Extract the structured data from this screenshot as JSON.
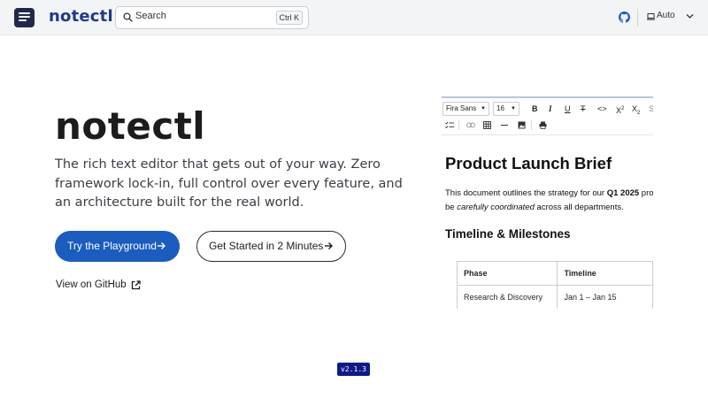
{
  "header": {
    "brand": "notectl",
    "search": {
      "placeholder": "Search",
      "shortcut": "Ctrl K"
    },
    "theme": {
      "label": "Auto"
    },
    "icons": {
      "logo": "notectl-logo-icon",
      "search": "search-icon",
      "github": "github-icon",
      "monitor": "monitor-icon",
      "chevron": "chevron-down-icon"
    },
    "accent_color": "#1d3a8a"
  },
  "hero": {
    "title": "notectl",
    "description": "The rich text editor that gets out of your way. Zero framework lock-in, full control over every feature, and an architecture built for the real world.",
    "primary_button": "Try the Playground",
    "secondary_button": "Get Started in 2 Minutes",
    "github_link": "View on GitHub",
    "primary_color": "#1a5cbf"
  },
  "editor_preview": {
    "toolbar": {
      "font_family": "Fira Sans",
      "font_size": "16",
      "buttons": [
        "bold",
        "italic",
        "underline",
        "strikethrough",
        "code",
        "superscript",
        "subscript",
        "checklist",
        "link",
        "table",
        "horizontal-rule",
        "image",
        "print"
      ]
    },
    "document": {
      "heading": "Product Launch Brief",
      "para_part1": "This document outlines the strategy for our ",
      "para_bold": "Q1 2025",
      "para_part2": " produc",
      "para_part3": "be ",
      "para_italic": "carefully coordinated",
      "para_part4": " across all departments.",
      "subheading": "Timeline & Milestones",
      "table": {
        "headers": [
          "Phase",
          "Timeline"
        ],
        "rows": [
          [
            "Research & Discovery",
            "Jan 1 – Jan 15"
          ]
        ]
      }
    }
  },
  "footer": {
    "version": "v2.1.3",
    "badge_color": "#0f1a8a"
  }
}
